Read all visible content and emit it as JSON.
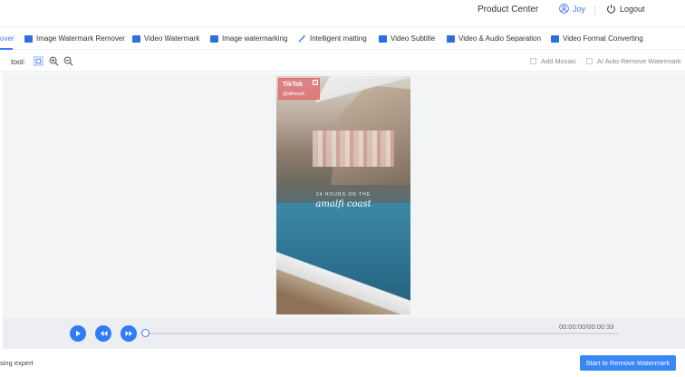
{
  "header": {
    "product_center": "Product Center",
    "user_name": "Joy",
    "logout_label": "Logout"
  },
  "tabs": [
    {
      "label": "over",
      "active": true,
      "icon": "none"
    },
    {
      "label": "Image Watermark Remover",
      "icon": "image-icon"
    },
    {
      "label": "Video Watermark",
      "icon": "video-icon"
    },
    {
      "label": "Image watermarking",
      "icon": "image-icon"
    },
    {
      "label": "Intelligent matting",
      "icon": "magic-wand-icon"
    },
    {
      "label": "Video Subtitle",
      "icon": "video-icon"
    },
    {
      "label": "Video & Audio Separation",
      "icon": "video-icon"
    },
    {
      "label": "Video Format Converting",
      "icon": "file-video-icon"
    }
  ],
  "toolbar": {
    "tool_label": "tool:",
    "add_mosaic_label": "Add Mosaic",
    "ai_remove_label": "AI Auto Remove Watermark"
  },
  "video": {
    "watermark_brand": "TikTok",
    "watermark_handle": "@allmorph",
    "caption_small": "24 HOURS ON THE",
    "caption_script": "amalfi coast"
  },
  "player": {
    "time": "00:00:00/00:00:33",
    "progress": 0
  },
  "footer": {
    "left_text": "sing expert",
    "start_button": "Start to Remove Watermark"
  },
  "colors": {
    "accent": "#3f7bf6",
    "button": "#3b86f6",
    "tab_icon": "#2f6ee0",
    "watermark_box": "#e64650"
  }
}
